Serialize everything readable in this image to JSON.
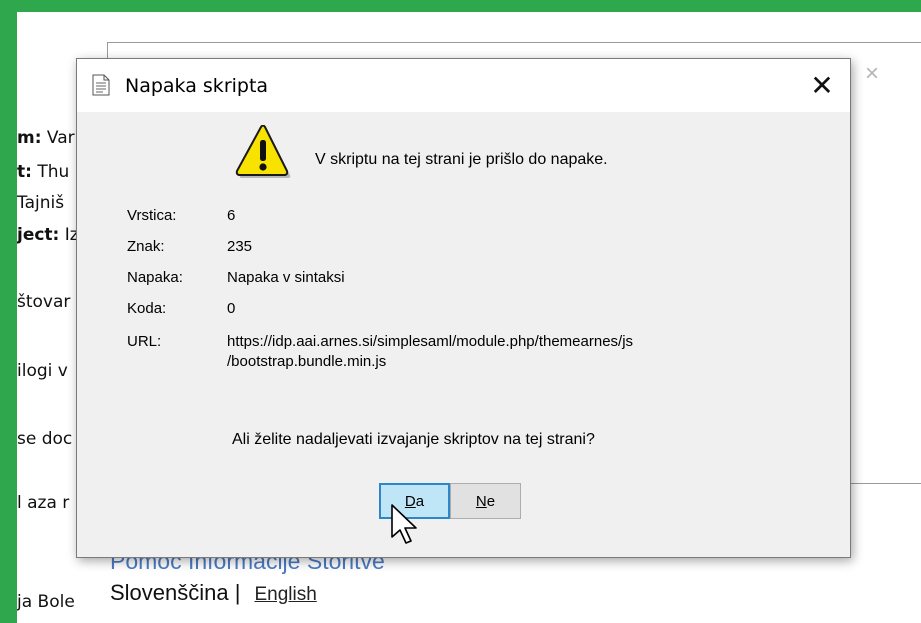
{
  "background": {
    "left_lines": [
      {
        "bold": "m:",
        "rest": " Var"
      },
      {
        "bold": "t:",
        "rest": " Thu"
      },
      {
        "bold": "",
        "rest": "Tajniš"
      },
      {
        "bold": "ject:",
        "rest": " Iz"
      },
      {
        "bold": "",
        "rest": "štovar"
      },
      {
        "bold": "",
        "rest": "ilogi v"
      },
      {
        "bold": "",
        "rest": "se doc"
      },
      {
        "bold": "",
        "rest": "l aza r"
      },
      {
        "bold": "",
        "rest": "ja Bole"
      }
    ],
    "help_links": "Pomoč Informacije Storitve",
    "language_current": "Slovenščina |",
    "language_link": "English",
    "close_glyph": "×"
  },
  "dialog": {
    "title": "Napaka skripta",
    "close_glyph": "✕",
    "message": "V skriptu na tej strani je prišlo do napake.",
    "details": [
      {
        "label": "Vrstica:",
        "value": "6"
      },
      {
        "label": "Znak:",
        "value": "235"
      },
      {
        "label": "Napaka:",
        "value": "Napaka v sintaksi"
      },
      {
        "label": "Koda:",
        "value": "0"
      },
      {
        "label": "URL:",
        "value": "https://idp.aai.arnes.si/simplesaml/module.php/themearnes/js",
        "value2": "/bootstrap.bundle.min.js"
      }
    ],
    "question": "Ali želite nadaljevati izvajanje skriptov na tej strani?",
    "yes_key": "D",
    "yes_rest": "a",
    "no_key": "N",
    "no_rest": "e"
  },
  "icons": {
    "title": "document-icon",
    "warning": "warning-icon",
    "pointer": "mouse-cursor-icon"
  },
  "colors": {
    "frame": "#2ea74d",
    "link": "#4a7ac4",
    "focus": "#2e86c9",
    "warning_fill": "#f7e200"
  }
}
